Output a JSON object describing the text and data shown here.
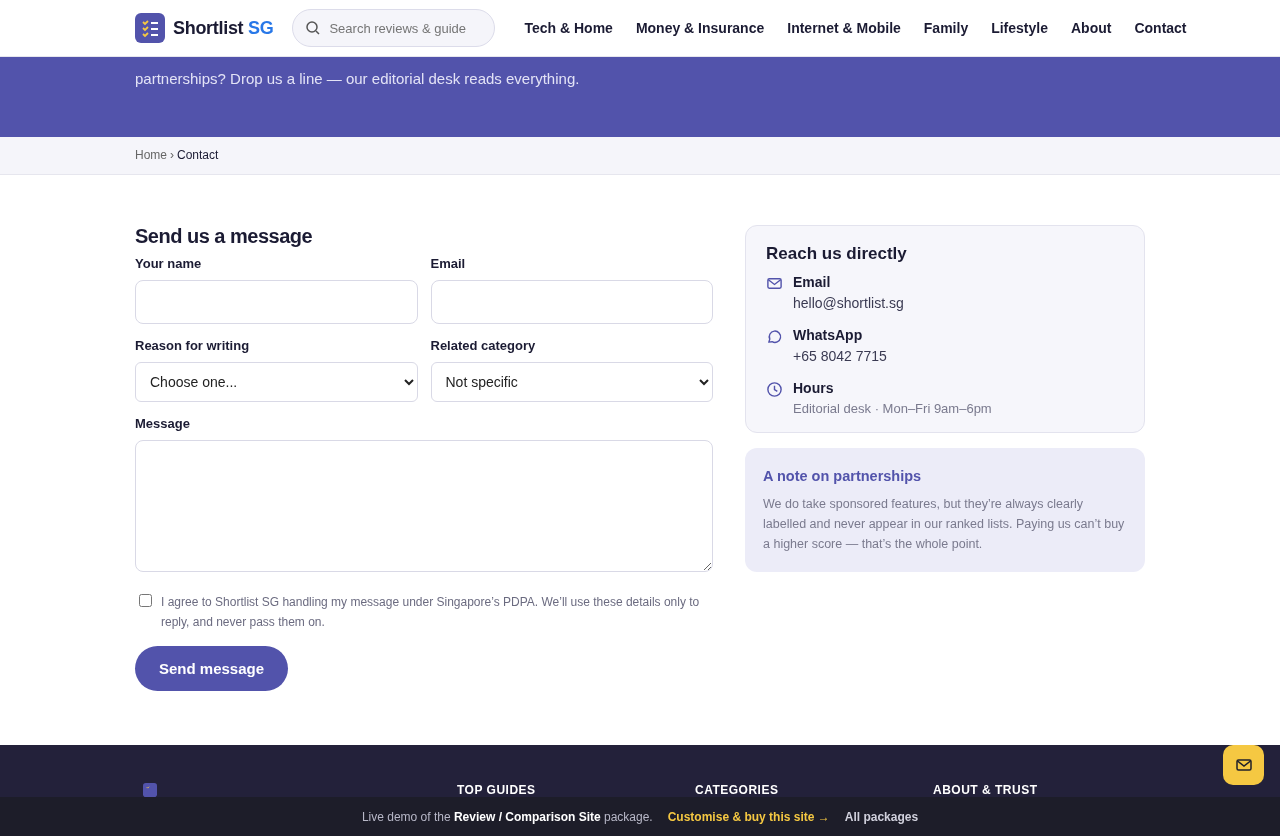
{
  "header": {
    "brand": {
      "name": "Shortlist",
      "accent": "SG"
    },
    "search": {
      "placeholder": "Search reviews & guide"
    },
    "nav": [
      {
        "label": "Tech & Home",
        "selected": false
      },
      {
        "label": "Money & Insurance",
        "selected": false
      },
      {
        "label": "Internet & Mobile",
        "selected": false
      },
      {
        "label": "Family",
        "selected": false
      },
      {
        "label": "Lifestyle",
        "selected": false
      },
      {
        "label": "About",
        "selected": false
      },
      {
        "label": "Contact",
        "selected": false
      }
    ]
  },
  "hero": {
    "text": "partnerships? Drop us a line — our editorial desk reads everything."
  },
  "breadcrumb": [
    {
      "label": "Home",
      "current": false
    },
    {
      "label": "Contact",
      "current": true
    }
  ],
  "breadcrumb_separator": "›",
  "form": {
    "title": "Send us a message",
    "fields": [
      {
        "kind": "text",
        "label": "Your name"
      },
      {
        "kind": "text",
        "label": "Email"
      },
      {
        "kind": "select",
        "label": "Reason for writing",
        "value": "Choose one..."
      },
      {
        "kind": "select",
        "label": "Related category",
        "value": "Not specific"
      },
      {
        "kind": "textarea",
        "label": "Message"
      }
    ],
    "consent": {
      "checked": false,
      "text": "I agree to Shortlist SG handling my message under Singapore’s PDPA. We’ll use these details only to reply, and never pass them on."
    },
    "submit": "Send message"
  },
  "contact_card": {
    "title": "Reach us directly",
    "items": [
      {
        "kind": "email",
        "label": "Email",
        "value": "hello@shortlist.sg",
        "muted": false
      },
      {
        "kind": "chat",
        "label": "WhatsApp",
        "value": "+65 8042 7715",
        "muted": false
      },
      {
        "kind": "clock",
        "label": "Hours",
        "value": "Editorial desk · Mon–Fri 9am–6pm",
        "muted": true
      }
    ]
  },
  "note_card": {
    "title": "A note on partnerships",
    "text": "We do take sponsored features, but they’re always clearly labelled and never appear in our ranked lists. Paying us can’t buy a higher score — that’s the whole point."
  },
  "footer": {
    "columns": [
      "TOP GUIDES",
      "CATEGORIES",
      "ABOUT & TRUST"
    ]
  },
  "demo_bar": {
    "text": "Live demo of the **Review / Comparison Site** package.",
    "cta": "Customise & buy this site →",
    "link": "All packages"
  }
}
